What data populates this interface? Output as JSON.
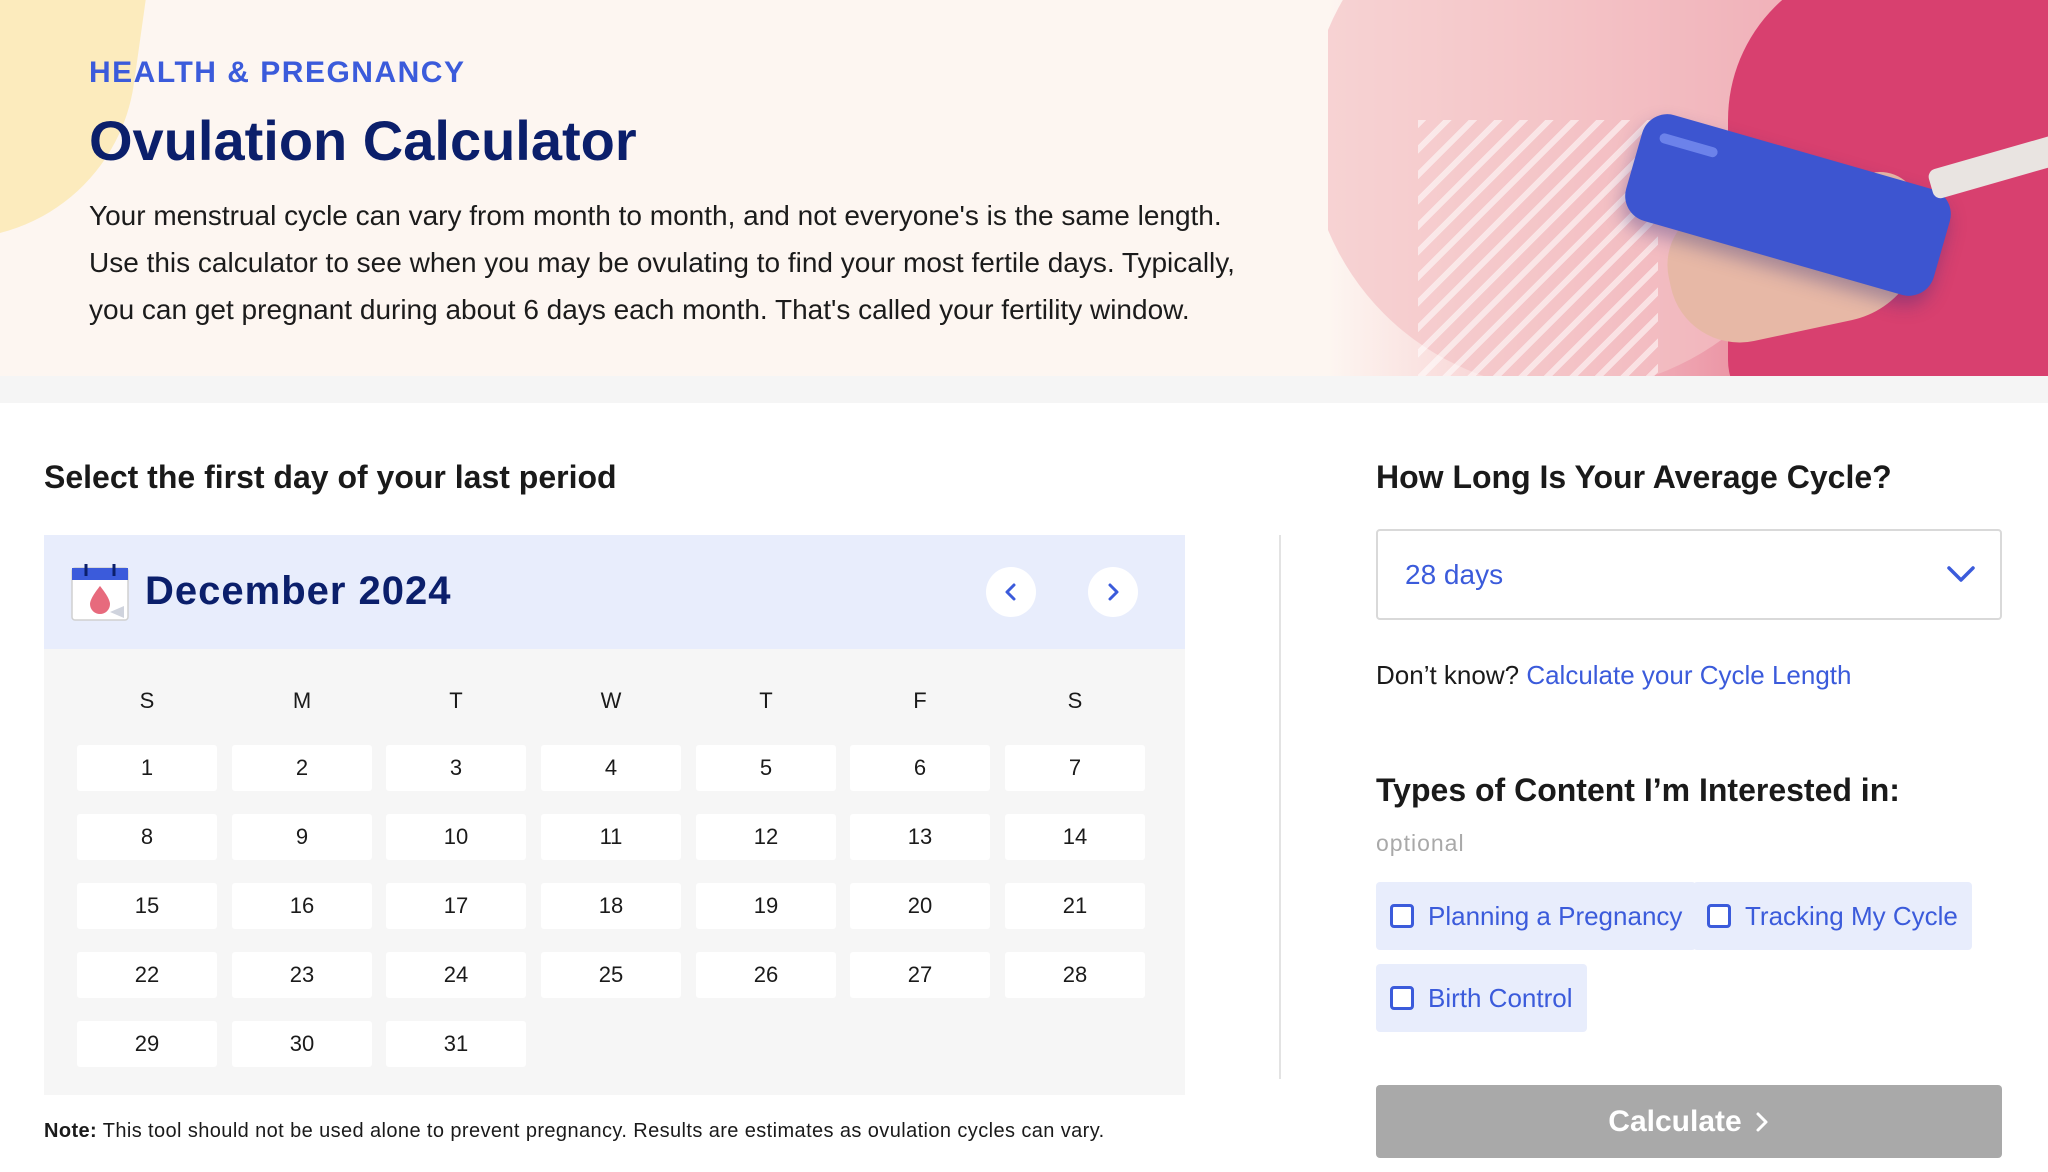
{
  "hero": {
    "eyebrow": "HEALTH & PREGNANCY",
    "title": "Ovulation Calculator",
    "description_lines": [
      "Your menstrual cycle can vary from month to month, and not everyone's is the same length.",
      "Use this calculator to see when you may be ovulating to find your most fertile days. Typically,",
      "you can get pregnant during about 6 days each month. That's called your fertility window."
    ]
  },
  "calendar": {
    "section_label": "Select the first day of your last period",
    "icon": "calendar-drop-icon",
    "month_label": "December 2024",
    "prev_icon": "chevron-left-icon",
    "next_icon": "chevron-right-icon",
    "weekdays": [
      "S",
      "M",
      "T",
      "W",
      "T",
      "F",
      "S"
    ],
    "weeks": [
      [
        "1",
        "2",
        "3",
        "4",
        "5",
        "6",
        "7"
      ],
      [
        "8",
        "9",
        "10",
        "11",
        "12",
        "13",
        "14"
      ],
      [
        "15",
        "16",
        "17",
        "18",
        "19",
        "20",
        "21"
      ],
      [
        "22",
        "23",
        "24",
        "25",
        "26",
        "27",
        "28"
      ],
      [
        "29",
        "30",
        "31"
      ]
    ]
  },
  "note": {
    "label": "Note:",
    "text": " This tool should not be used alone to prevent pregnancy. Results are estimates as ovulation cycles can vary."
  },
  "cycle": {
    "heading": "How Long Is Your Average Cycle?",
    "selected": "28 days",
    "dropdown_icon": "chevron-down-icon",
    "help_prefix": "Don’t know?",
    "help_link": "Calculate your Cycle Length"
  },
  "content_types": {
    "heading": "Types of Content I’m Interested in:",
    "optional": "optional",
    "options": [
      "Planning a Pregnancy",
      "Tracking My Cycle",
      "Birth Control"
    ]
  },
  "calculate_button": {
    "label": "Calculate",
    "icon": "chevron-right-icon"
  },
  "colors": {
    "accent": "#3b5bdb",
    "navy": "#0b1f6b",
    "calendar_header": "#e8edfc",
    "button_disabled": "#a9a9a9"
  }
}
